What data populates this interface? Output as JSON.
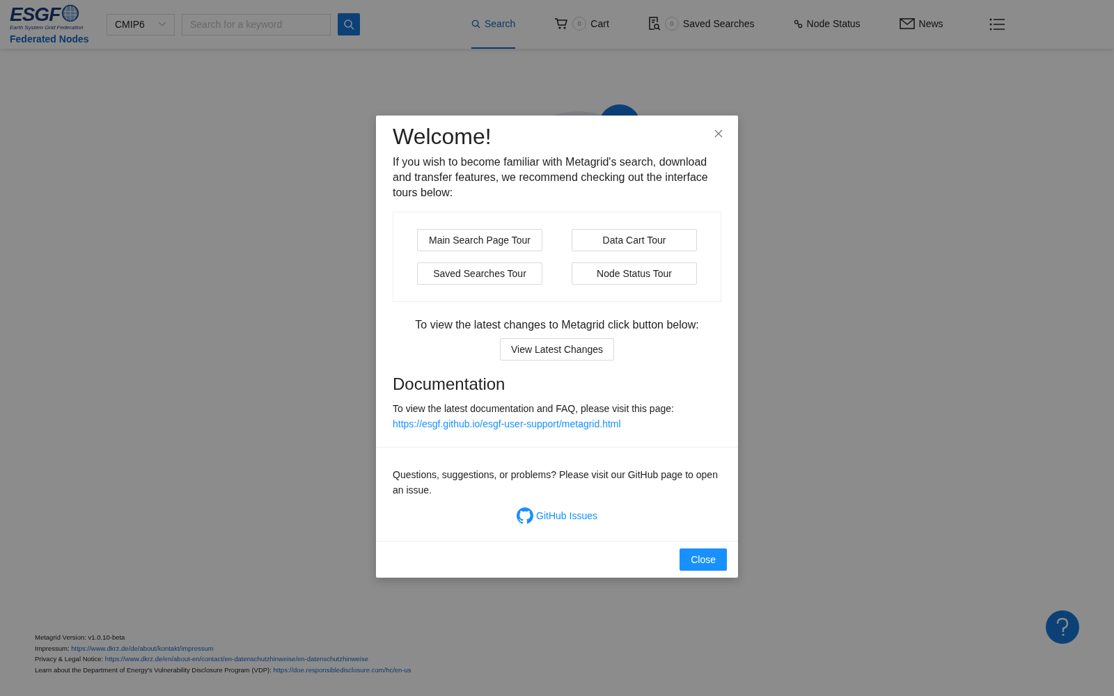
{
  "header": {
    "logo": {
      "text": "ESGF",
      "subtitle": "Earth System Grid Federation"
    },
    "federated_nodes": "Federated Nodes",
    "project_select": {
      "value": "CMIP6"
    },
    "search": {
      "placeholder": "Search for a keyword"
    },
    "nav": [
      {
        "kind": "search",
        "label": "Search",
        "selected": true
      },
      {
        "kind": "cart",
        "label": "Cart",
        "badge": "0",
        "selected": false
      },
      {
        "kind": "saved",
        "label": "Saved Searches",
        "badge": "0",
        "selected": false
      },
      {
        "kind": "node",
        "label": "Node Status",
        "selected": false
      },
      {
        "kind": "news",
        "label": "News",
        "selected": false
      }
    ]
  },
  "modal": {
    "title": "Welcome!",
    "intro": "If you wish to become familiar with Metagrid's search, download and transfer features, we recommend checking out the interface tours below:",
    "tours": [
      "Main Search Page Tour",
      "Data Cart Tour",
      "Saved Searches Tour",
      "Node Status Tour"
    ],
    "changes_text": "To view the latest changes to Metagrid click button below:",
    "changes_button": "View Latest Changes",
    "doc_heading": "Documentation",
    "doc_text": "To view the latest documentation and FAQ, please visit this page:",
    "doc_link": "https://esgf.github.io/esgf-user-support/metagrid.html",
    "questions_text": "Questions, suggestions, or problems? Please visit our GitHub page to open an issue.",
    "github_link": "GitHub Issues",
    "close_button": "Close"
  },
  "footer": [
    {
      "label": "Metagrid Version: v1.0.10-beta"
    },
    {
      "label": "Impressum:",
      "link": "https://www.dkrz.de/de/about/kontakt/impressum"
    },
    {
      "label": "Privacy & Legal Notice:",
      "link": "https://www.dkrz.de/en/about-en/contact/en-datenschutzhinweise/en-datenschutzhinweise"
    },
    {
      "label": "Learn about the Department of Energy's Vulnerability Disclosure Program (VDP):",
      "link": "https://doe.responsibledisclosure.com/hc/en-us"
    }
  ]
}
